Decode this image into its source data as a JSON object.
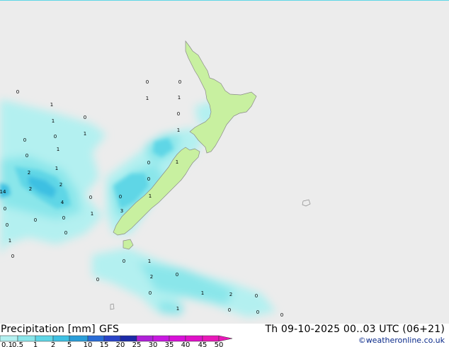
{
  "product": "Precipitation [mm]",
  "model": "GFS",
  "valid_time": "Th 09-10-2025 00..03 UTC (06+21)",
  "credit": "©weatheronline.co.uk",
  "colorbar": {
    "ticks": [
      "0.1",
      "0.5",
      "1",
      "2",
      "5",
      "10",
      "15",
      "20",
      "25",
      "30",
      "35",
      "40",
      "45",
      "50"
    ],
    "colors": [
      "#b3f0f0",
      "#8ae6ea",
      "#5fd6e6",
      "#3ec0e2",
      "#2a9ed8",
      "#2a6cd6",
      "#2a44c8",
      "#1c2aa8",
      "#b020d8",
      "#c818e0",
      "#d810d8",
      "#e010c8",
      "#e818b8"
    ]
  },
  "colors": {
    "land": "#c8f0a0",
    "sea": "#ececec"
  },
  "labels": [
    "0",
    "1",
    "1",
    "0",
    "0",
    "1",
    "0",
    "1",
    "1",
    "0",
    "0",
    "1",
    "0",
    "0",
    "1",
    "0",
    "1",
    "0",
    "1",
    "0",
    "0",
    "1",
    "1",
    "4",
    "14",
    "3",
    "2",
    "2",
    "2",
    "0",
    "0",
    "0",
    "0",
    "0",
    "1",
    "0",
    "2",
    "0",
    "0",
    "0",
    "0",
    "1",
    "1",
    "2",
    "0",
    "0",
    "1",
    "0",
    "0"
  ]
}
